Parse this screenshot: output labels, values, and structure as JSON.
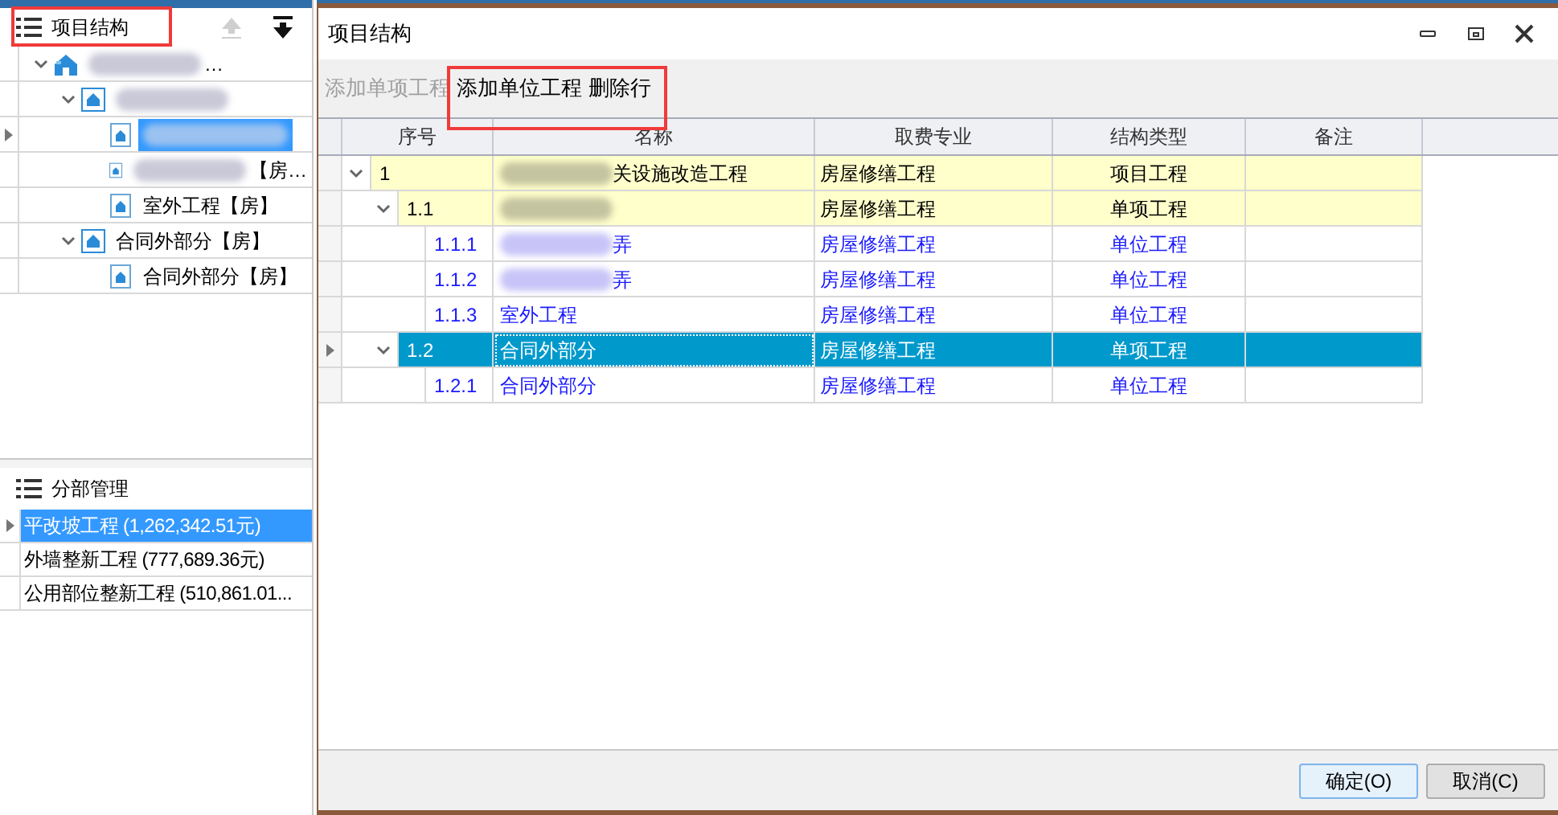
{
  "structure_panel": {
    "title": "项目结构",
    "tree": [
      {
        "kind": "project",
        "label": "…",
        "redacted": true,
        "expanded": true,
        "selected": false,
        "children": [
          {
            "kind": "single",
            "redacted": true,
            "expanded": true,
            "selected": false,
            "children": [
              {
                "kind": "unit",
                "redacted": true,
                "selected": true
              },
              {
                "kind": "unit",
                "label": "【房…",
                "redacted": true,
                "selected": false
              },
              {
                "kind": "unit",
                "label": "室外工程【房】",
                "selected": false
              }
            ]
          },
          {
            "kind": "single",
            "label": "合同外部分【房】",
            "expanded": true,
            "selected": false,
            "children": [
              {
                "kind": "unit",
                "label": "合同外部分【房】",
                "selected": false
              }
            ]
          }
        ]
      }
    ]
  },
  "division_panel": {
    "title": "分部管理",
    "items": [
      {
        "label": "平改坡工程 (1,262,342.51元)",
        "selected": true
      },
      {
        "label": "外墙整新工程 (777,689.36元)",
        "selected": false
      },
      {
        "label": "公用部位整新工程 (510,861.01...",
        "selected": false
      }
    ]
  },
  "dialog": {
    "title": "项目结构",
    "toolbar": [
      {
        "label": "添加单项工程",
        "disabled": true
      },
      {
        "label": "添加单位工程",
        "disabled": false
      },
      {
        "label": "删除行",
        "disabled": false
      }
    ],
    "columns": [
      "序号",
      "名称",
      "取费专业",
      "结构类型",
      "备注"
    ],
    "rows": [
      {
        "kind": "project",
        "number": "1",
        "name": "关设施改造工程",
        "redacted": true,
        "fee": "房屋修缮工程",
        "type": "项目工程",
        "expanded": true,
        "selected": false,
        "children": [
          {
            "kind": "single",
            "number": "1.1",
            "redacted": true,
            "fee": "房屋修缮工程",
            "type": "单项工程",
            "expanded": true,
            "selected": false,
            "children": [
              {
                "kind": "unit",
                "number": "1.1.1",
                "name": "弄",
                "redacted": true,
                "fee": "房屋修缮工程",
                "type": "单位工程",
                "selected": false
              },
              {
                "kind": "unit",
                "number": "1.1.2",
                "name": "弄",
                "redacted": true,
                "fee": "房屋修缮工程",
                "type": "单位工程",
                "selected": false
              },
              {
                "kind": "unit",
                "number": "1.1.3",
                "name": "室外工程",
                "fee": "房屋修缮工程",
                "type": "单位工程",
                "selected": false
              }
            ]
          },
          {
            "kind": "single",
            "number": "1.2",
            "name": "合同外部分",
            "fee": "房屋修缮工程",
            "type": "单项工程",
            "expanded": true,
            "selected": true,
            "children": [
              {
                "kind": "unit",
                "number": "1.2.1",
                "name": "合同外部分",
                "fee": "房屋修缮工程",
                "type": "单位工程",
                "selected": false
              }
            ]
          }
        ]
      }
    ],
    "buttons": [
      "确定(O)",
      "取消(C)"
    ]
  }
}
